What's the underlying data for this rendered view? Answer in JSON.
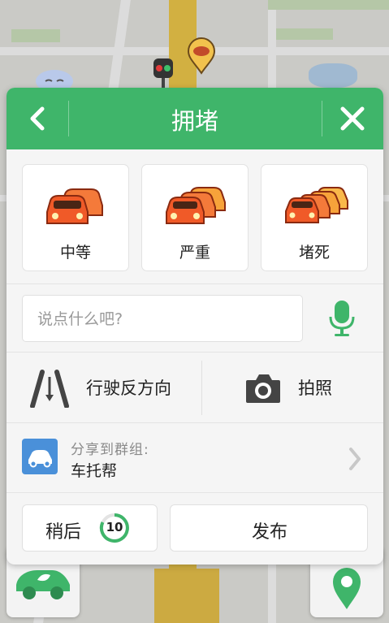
{
  "header": {
    "title": "拥堵"
  },
  "severity": [
    {
      "label": "中等",
      "cars": 2
    },
    {
      "label": "严重",
      "cars": 3
    },
    {
      "label": "堵死",
      "cars": 4
    }
  ],
  "comment": {
    "placeholder": "说点什么吧?"
  },
  "actions": {
    "reverse_label": "行驶反方向",
    "photo_label": "拍照"
  },
  "share": {
    "label": "分享到群组:",
    "group": "车托帮"
  },
  "bottom": {
    "later_label": "稍后",
    "countdown": "10",
    "publish_label": "发布"
  },
  "colors": {
    "header": "#3fb56a",
    "accent": "#3fb56a",
    "car": "#f05a28",
    "share_icon": "#4a90d9"
  }
}
